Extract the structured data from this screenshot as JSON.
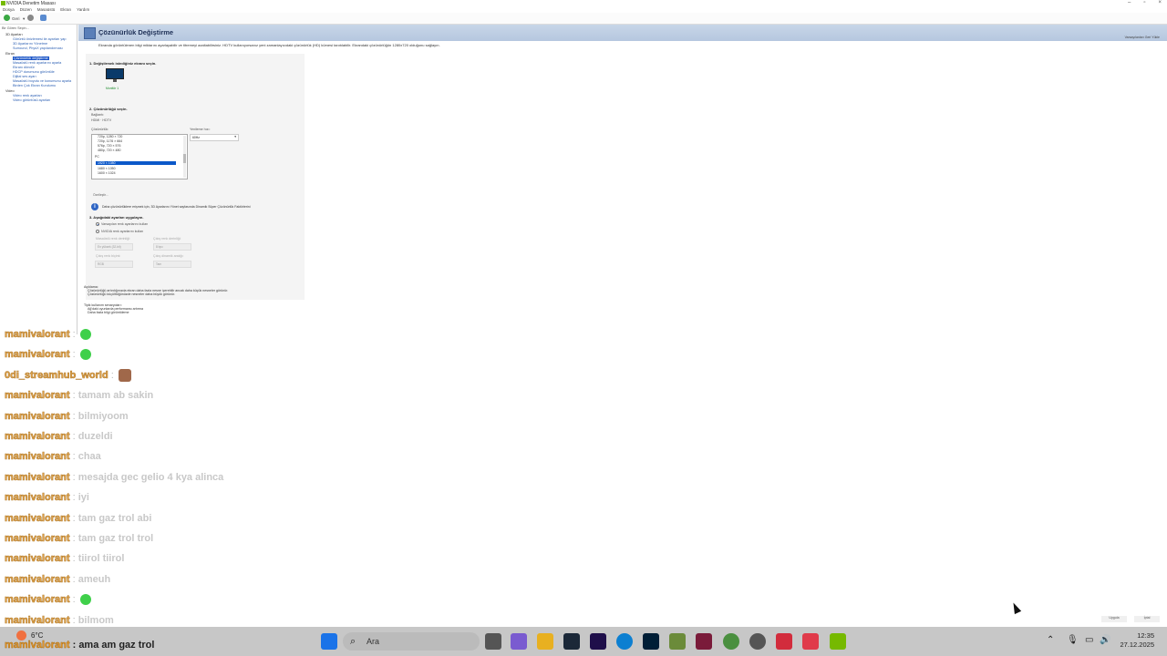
{
  "window": {
    "title": "NVIDIA Denetim Masası",
    "menu": [
      "Dosya",
      "Düzen",
      "Masaüstü",
      "Ekran",
      "Yardım"
    ],
    "toolbar_back": "Geri"
  },
  "tree": {
    "header": "Bir Görev Seçin...",
    "items": [
      {
        "label": "3D Ayarları",
        "kind": "cat"
      },
      {
        "label": "Görüntü önizlemesi ile ayarları yap",
        "kind": "leaf"
      },
      {
        "label": "3D Ayarlarını Yönetme",
        "kind": "leaf"
      },
      {
        "label": "Surround, PhysX yapılandırması",
        "kind": "leaf"
      },
      {
        "label": "Ekran",
        "kind": "cat"
      },
      {
        "label": "Çözünürlük değiştirme",
        "kind": "selected"
      },
      {
        "label": "Masaüstü renk ayarlarını ayarla",
        "kind": "leaf"
      },
      {
        "label": "Ekranı döndür",
        "kind": "leaf"
      },
      {
        "label": "HDCP durumunu görüntüle",
        "kind": "leaf"
      },
      {
        "label": "Dijital ses ayarı",
        "kind": "leaf"
      },
      {
        "label": "Masaüstü boyutu ve konumunu ayarla",
        "kind": "leaf"
      },
      {
        "label": "Birden Çok Ekran Kurulumu",
        "kind": "leaf"
      },
      {
        "label": "Video",
        "kind": "cat"
      },
      {
        "label": "Video renk ayarları",
        "kind": "leaf"
      },
      {
        "label": "Video görüntüsü ayarları",
        "kind": "leaf"
      }
    ]
  },
  "main": {
    "title": "Çözünürlük Değiştirme",
    "restore": "Varsayılanları Geri Yükle",
    "intro": "Ekranda görüntülenen bilgi miktarını ayarlayabilir ve titremeyi azaltabilirsiniz. HDTV kullanıyorsanız yeni zamanlayıcıdaki çözünürlük (HD) kümesi tanıtılabilir. Ekrandaki çözünürlüğün 1280x720 olduğunu sağlayın.",
    "step1": "1. Değiştirmek istediğiniz ekranı seçin.",
    "monitor_label": "Monitör 1",
    "step2": "2. Çözünürlüğü seçin.",
    "connection_label": "Bağlantı:",
    "connection_value": "HDMI · HDTV",
    "resolution_label": "Çözünürlük:",
    "refresh_label": "Yenileme hızı:",
    "refresh_value": "60Hz",
    "resolutions": [
      {
        "label": "720p, 1280 × 720",
        "selected": false
      },
      {
        "label": "720p, 1176 × 664",
        "selected": false
      },
      {
        "label": "576p, 720 × 576",
        "selected": false
      },
      {
        "label": "480p, 720 × 480",
        "selected": false
      },
      {
        "label": "PC",
        "selected": false
      },
      {
        "label": "1920 × 1080",
        "selected": true
      },
      {
        "label": "1680 × 1050",
        "selected": false
      },
      {
        "label": "1600 × 1024",
        "selected": false
      }
    ],
    "custom_button": "Özelleştir...",
    "info_text": "Daha çözünürlüklere erişmek için, 3D Ayarlarını Yönet sayfasında Dinamik Süper Çözünürlük Faktörlerini",
    "step3": "3. Aşağıdaki ayarları uygulayın.",
    "radio_default": "Varsayılan renk ayarlarını kullan",
    "radio_nvidia": "NVIDIA renk ayarlarını kullan",
    "field_labels": [
      "Masaüstü renk derinliği:",
      "Çıkış renk derinliği:",
      "Çıkış renk biçimi:",
      "Çıkış dinamik aralığı:"
    ],
    "field_values": [
      "En yüksek (32-bit)",
      "8 bpc",
      "RGB",
      "Tam"
    ],
    "desc_heading": "Açıklama:",
    "desc_text": "Çözünürlüğü artırdığınızda ekran daha fazla nesne içerebilir ancak daha küçük nesneler görünür.",
    "desc_text2": "Çözünürlüğü küçülttüğünüzde nesneler daha büyük görünür.",
    "scenario_heading": "Tipik kullanım senaryoları:",
    "scenario_1": "Ağ'daki oyunlarda performansı artırma",
    "scenario_2": "Daha fazla bilgi görüntüleme"
  },
  "chat": [
    {
      "user": "mamivalorant",
      "msg": "",
      "emote": "green"
    },
    {
      "user": "mamivalorant",
      "msg": "",
      "emote": "green"
    },
    {
      "user": "0di_streamhub_world",
      "msg": "",
      "emote": "face"
    },
    {
      "user": "mamivalorant",
      "msg": "tamam ab sakin",
      "emote": ""
    },
    {
      "user": "mamivalorant",
      "msg": "bilmiyoom",
      "emote": ""
    },
    {
      "user": "mamivalorant",
      "msg": "duzeldi",
      "emote": ""
    },
    {
      "user": "mamivalorant",
      "msg": "chaa",
      "emote": ""
    },
    {
      "user": "mamivalorant",
      "msg": "mesajda gec gelio 4 kya alinca",
      "emote": ""
    },
    {
      "user": "mamivalorant",
      "msg": "iyi",
      "emote": ""
    },
    {
      "user": "mamivalorant",
      "msg": "tam gaz trol abi",
      "emote": ""
    },
    {
      "user": "mamivalorant",
      "msg": "tam gaz trol trol",
      "emote": ""
    },
    {
      "user": "mamivalorant",
      "msg": "tiirol tiirol",
      "emote": ""
    },
    {
      "user": "mamivalorant",
      "msg": "ameuh",
      "emote": ""
    },
    {
      "user": "mamivalorant",
      "msg": "",
      "emote": "green"
    },
    {
      "user": "mamivalorant",
      "msg": "bilmom",
      "emote": ""
    }
  ],
  "bottom_buttons": {
    "apply": "Uygula",
    "cancel": "İptal"
  },
  "taskbar": {
    "weather_temp": "6°C",
    "overlay_user": "mamivalorant",
    "overlay_msg": "ama am gaz trol",
    "search_placeholder": "Ara",
    "time": "12:35",
    "date": "27.12.2025",
    "colors": {
      "start": "#1a73e8",
      "accent": "#e0952a"
    }
  }
}
